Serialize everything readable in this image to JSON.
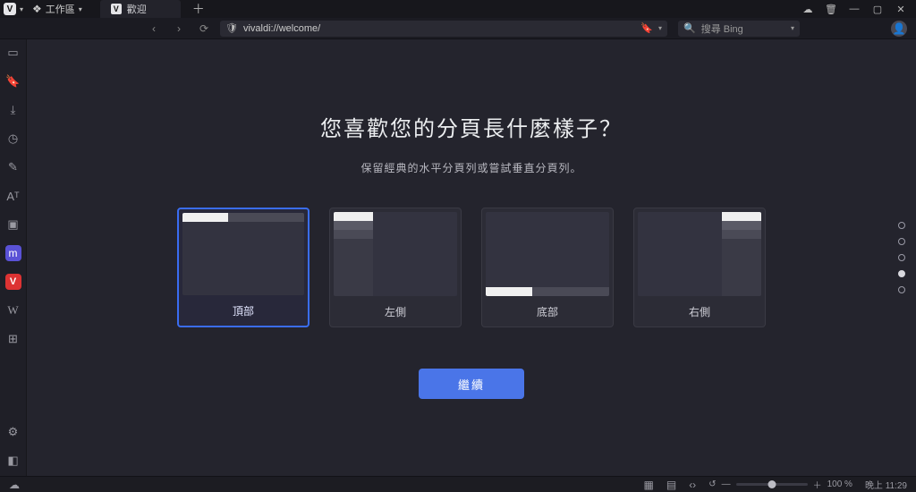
{
  "titlebar": {
    "workspace_label": "工作區",
    "tab_title": "歡迎"
  },
  "addressbar": {
    "url": "vivaldi://welcome/",
    "search_placeholder": "搜尋 Bing"
  },
  "welcome": {
    "question": "您喜歡您的分頁長什麼樣子？",
    "subtitle": "保留經典的水平分頁列或嘗試垂直分頁列。",
    "options": {
      "top": "頂部",
      "left": "左側",
      "bottom": "底部",
      "right": "右側"
    },
    "selected_option": "top",
    "continue_label": "繼續",
    "current_step": 4,
    "total_steps": 5
  },
  "statusbar": {
    "zoom_label": "100 %",
    "clock": "晚上 11:29"
  }
}
